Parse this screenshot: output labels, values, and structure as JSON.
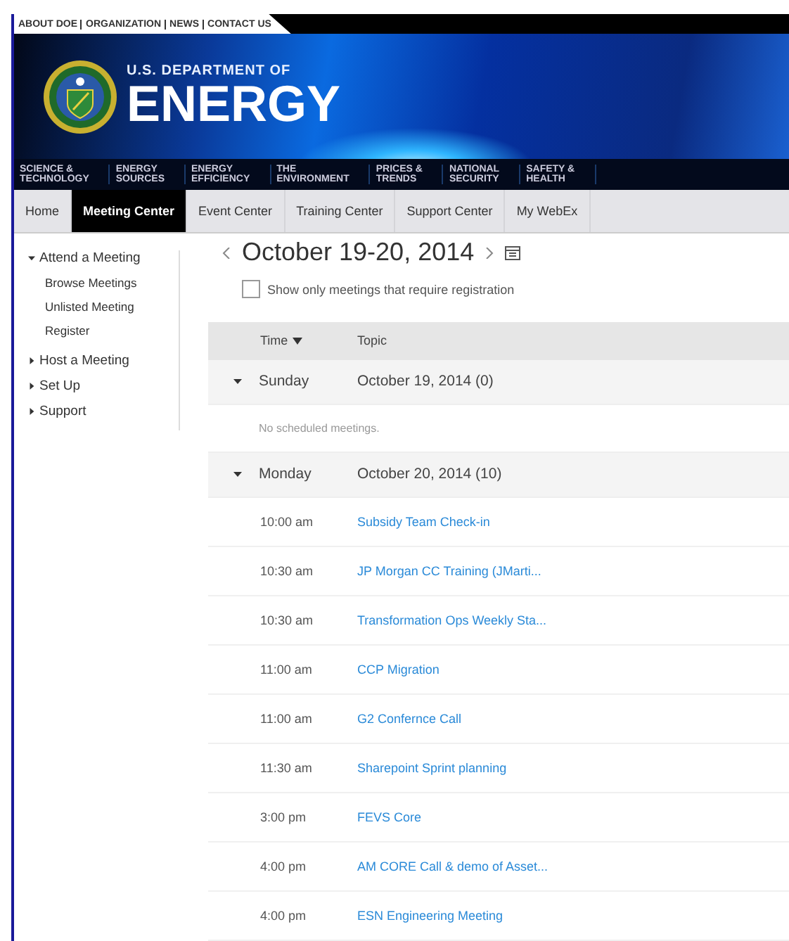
{
  "utility_links": [
    "ABOUT DOE",
    "ORGANIZATION",
    "NEWS",
    "CONTACT US"
  ],
  "banner": {
    "line1": "U.S. DEPARTMENT OF",
    "line2": "ENERGY"
  },
  "categories": [
    {
      "line1": "SCIENCE &",
      "line2": "TECHNOLOGY"
    },
    {
      "line1": "ENERGY",
      "line2": "SOURCES"
    },
    {
      "line1": "ENERGY",
      "line2": "EFFICIENCY"
    },
    {
      "line1": "THE",
      "line2": "ENVIRONMENT"
    },
    {
      "line1": "PRICES &",
      "line2": "TRENDS"
    },
    {
      "line1": "NATIONAL",
      "line2": "SECURITY"
    },
    {
      "line1": "SAFETY &",
      "line2": "HEALTH"
    }
  ],
  "tabs": [
    {
      "label": "Home",
      "selected": false
    },
    {
      "label": "Meeting Center",
      "selected": true
    },
    {
      "label": "Event Center",
      "selected": false
    },
    {
      "label": "Training Center",
      "selected": false
    },
    {
      "label": "Support Center",
      "selected": false
    },
    {
      "label": "My WebEx",
      "selected": false
    }
  ],
  "sidebar": {
    "items": [
      {
        "label": "Attend a Meeting",
        "expanded": true,
        "children": [
          {
            "label": "Browse Meetings"
          },
          {
            "label": "Unlisted Meeting"
          },
          {
            "label": "Register"
          }
        ]
      },
      {
        "label": "Host a Meeting",
        "expanded": false
      },
      {
        "label": "Set Up",
        "expanded": false
      },
      {
        "label": "Support",
        "expanded": false
      }
    ]
  },
  "date_range": "October 19-20, 2014",
  "filter": {
    "label": "Show only meetings that require registration",
    "checked": false
  },
  "table": {
    "columns": [
      {
        "label": "Time",
        "sorted": true
      },
      {
        "label": "Topic",
        "sorted": false
      }
    ],
    "days": [
      {
        "day": "Sunday",
        "date": "October 19, 2014 (0)",
        "expanded": true,
        "empty_text": "No scheduled meetings."
      },
      {
        "day": "Monday",
        "date": "October 20, 2014 (10)",
        "expanded": true,
        "meetings": [
          {
            "time": "10:00 am",
            "topic": "Subsidy Team Check-in"
          },
          {
            "time": "10:30 am",
            "topic": "JP Morgan CC Training (JMarti..."
          },
          {
            "time": "10:30 am",
            "topic": "Transformation Ops Weekly Sta..."
          },
          {
            "time": "11:00 am",
            "topic": "CCP Migration"
          },
          {
            "time": "11:00 am",
            "topic": "G2 Confernce Call"
          },
          {
            "time": "11:30 am",
            "topic": "Sharepoint Sprint planning"
          },
          {
            "time": "3:00 pm",
            "topic": "FEVS Core"
          },
          {
            "time": "4:00 pm",
            "topic": "AM CORE Call & demo of Asset..."
          },
          {
            "time": "4:00 pm",
            "topic": "ESN Engineering Meeting"
          }
        ]
      }
    ]
  }
}
